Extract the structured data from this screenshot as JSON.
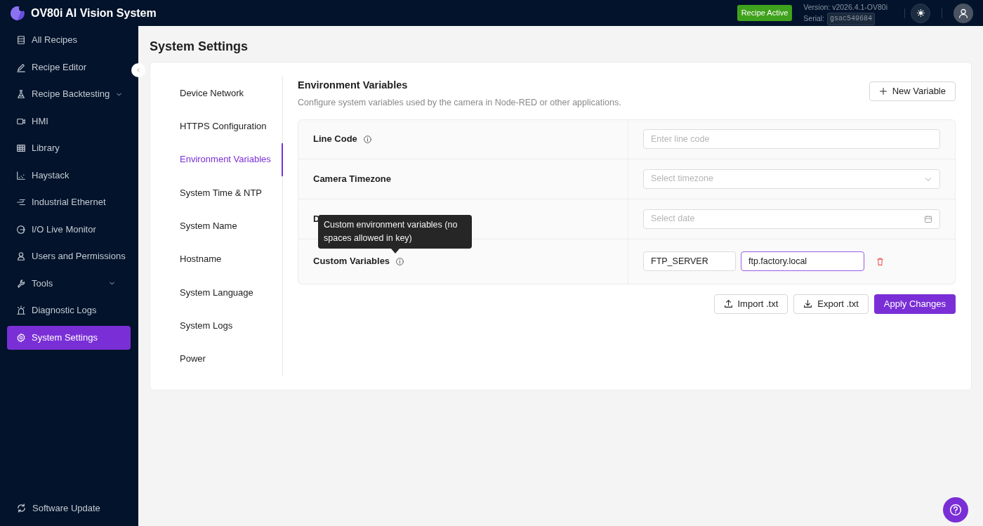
{
  "header": {
    "title": "OV80i AI Vision System",
    "status_badge": "Recipe Active",
    "version": "Version: v2026.4.1-OV80i",
    "serial_label": "Serial:",
    "serial": "gsac549684"
  },
  "sidebar": {
    "items": [
      {
        "label": "All Recipes",
        "selected": false,
        "submenu": false
      },
      {
        "label": "Recipe Editor",
        "selected": false,
        "submenu": false
      },
      {
        "label": "Recipe Backtesting",
        "selected": false,
        "submenu": true
      },
      {
        "label": "HMI",
        "selected": false,
        "submenu": false
      },
      {
        "label": "Library",
        "selected": false,
        "submenu": false
      },
      {
        "label": "Haystack",
        "selected": false,
        "submenu": false
      },
      {
        "label": "Industrial Ethernet",
        "selected": false,
        "submenu": false
      },
      {
        "label": "I/O Live Monitor",
        "selected": false,
        "submenu": false
      },
      {
        "label": "Users and Permissions",
        "selected": false,
        "submenu": false
      },
      {
        "label": "Tools",
        "selected": false,
        "submenu": true
      },
      {
        "label": "Diagnostic Logs",
        "selected": false,
        "submenu": false
      },
      {
        "label": "System Settings",
        "selected": true,
        "submenu": false
      }
    ],
    "footer_item": "Software Update"
  },
  "page_title": "System Settings",
  "settings_nav": [
    {
      "label": "Device Network",
      "selected": false
    },
    {
      "label": "HTTPS Configuration",
      "selected": false
    },
    {
      "label": "Environment Variables",
      "selected": true
    },
    {
      "label": "System Time & NTP",
      "selected": false
    },
    {
      "label": "System Name",
      "selected": false
    },
    {
      "label": "Hostname",
      "selected": false
    },
    {
      "label": "System Language",
      "selected": false
    },
    {
      "label": "System Logs",
      "selected": false
    },
    {
      "label": "Power",
      "selected": false
    }
  ],
  "section": {
    "title": "Environment Variables",
    "description": "Configure system variables used by the camera in Node-RED or other applications.",
    "new_button": "New Variable"
  },
  "fields": [
    {
      "kind": "text",
      "label": "Line Code",
      "info": true,
      "placeholder": "Enter line code"
    },
    {
      "kind": "select",
      "label": "Camera Timezone",
      "info": false,
      "placeholder": "Select timezone"
    },
    {
      "kind": "date",
      "label": "D",
      "info": false,
      "placeholder": "Select date"
    },
    {
      "kind": "custom",
      "label": "Custom Variables",
      "info": true,
      "key": "FTP_SERVER",
      "value": "ftp.factory.local",
      "focused": true,
      "tooltip": "Custom environment variables (no spaces allowed in key)"
    }
  ],
  "actions": [
    {
      "kind": "import",
      "label": "Import .txt"
    },
    {
      "kind": "export",
      "label": "Export .txt"
    },
    {
      "kind": "apply",
      "label": "Apply Changes"
    }
  ]
}
